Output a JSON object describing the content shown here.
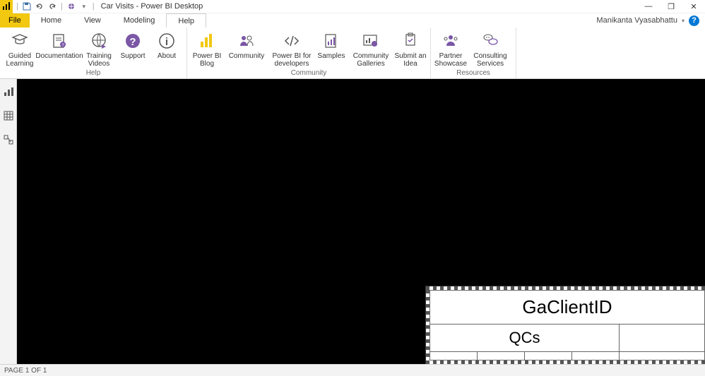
{
  "title_bar": {
    "app_title": "Car Visits - Power BI Desktop",
    "qat_dropdown": "▾"
  },
  "window_controls": {
    "minimize": "—",
    "maximize": "❐",
    "close": "✕"
  },
  "tabs": {
    "file": "File",
    "home": "Home",
    "view": "View",
    "modeling": "Modeling",
    "help": "Help"
  },
  "user": {
    "name": "Manikanta Vyasabhattu",
    "help": "?"
  },
  "ribbon": {
    "groups": {
      "help": {
        "label": "Help",
        "guided": "Guided Learning",
        "documentation": "Documentation",
        "training": "Training Videos",
        "support": "Support",
        "about": "About"
      },
      "community": {
        "label": "Community",
        "blog": "Power BI Blog",
        "community": "Community",
        "devs": "Power BI for developers",
        "samples": "Samples",
        "galleries": "Community Galleries",
        "idea": "Submit an Idea"
      },
      "resources": {
        "label": "Resources",
        "partner": "Partner Showcase",
        "consulting": "Consulting Services"
      }
    }
  },
  "views": {
    "report": "report-view",
    "data": "data-view",
    "model": "model-view"
  },
  "table": {
    "header_top": "GaClientID",
    "header_sub": "QCs"
  },
  "status": {
    "page": "PAGE 1 OF 1"
  }
}
